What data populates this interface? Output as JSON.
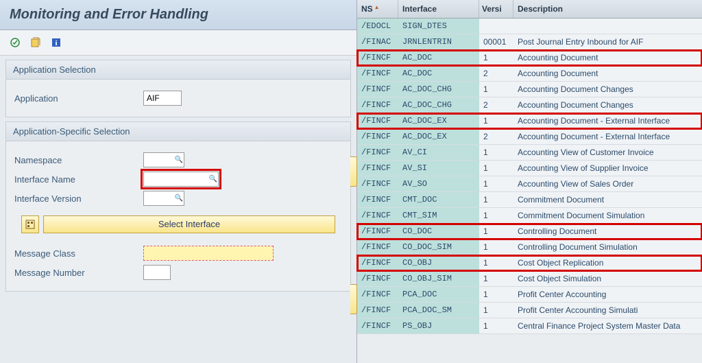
{
  "title": "Monitoring and Error Handling",
  "toolbar": {
    "execute_icon": "execute-icon",
    "variant_icon": "variant-icon",
    "info_icon": "info-icon"
  },
  "panels": {
    "appsel": {
      "title": "Application Selection",
      "app_label": "Application",
      "app_value": "AIF"
    },
    "specsel": {
      "title": "Application-Specific Selection",
      "ns_label": "Namespace",
      "ifname_label": "Interface Name",
      "ifver_label": "Interface Version",
      "select_btn": "Select Interface",
      "msgclass_label": "Message Class",
      "msgnum_label": "Message Number"
    }
  },
  "grid": {
    "headers": {
      "ns": "NS",
      "iface": "Interface",
      "version": "Versi",
      "desc": "Description"
    },
    "rows": [
      {
        "ns": "/EDOCL",
        "iface": "SIGN_DTES",
        "ver": "",
        "desc": "",
        "hl": false
      },
      {
        "ns": "/FINAC",
        "iface": "JRNLENTRIN",
        "ver": "00001",
        "desc": "Post Journal Entry Inbound for AIF",
        "hl": false
      },
      {
        "ns": "/FINCF",
        "iface": "AC_DOC",
        "ver": "1",
        "desc": "Accounting Document",
        "hl": true
      },
      {
        "ns": "/FINCF",
        "iface": "AC_DOC",
        "ver": "2",
        "desc": "Accounting Document",
        "hl": false
      },
      {
        "ns": "/FINCF",
        "iface": "AC_DOC_CHG",
        "ver": "1",
        "desc": "Accounting Document Changes",
        "hl": false
      },
      {
        "ns": "/FINCF",
        "iface": "AC_DOC_CHG",
        "ver": "2",
        "desc": "Accounting Document Changes",
        "hl": false
      },
      {
        "ns": "/FINCF",
        "iface": "AC_DOC_EX",
        "ver": "1",
        "desc": "Accounting Document - External Interface",
        "hl": true
      },
      {
        "ns": "/FINCF",
        "iface": "AC_DOC_EX",
        "ver": "2",
        "desc": "Accounting Document - External Interface",
        "hl": false
      },
      {
        "ns": "/FINCF",
        "iface": "AV_CI",
        "ver": "1",
        "desc": "Accounting View of Customer Invoice",
        "hl": false
      },
      {
        "ns": "/FINCF",
        "iface": "AV_SI",
        "ver": "1",
        "desc": "Accounting View of Supplier Invoice",
        "hl": false
      },
      {
        "ns": "/FINCF",
        "iface": "AV_SO",
        "ver": "1",
        "desc": "Accounting View of Sales Order",
        "hl": false
      },
      {
        "ns": "/FINCF",
        "iface": "CMT_DOC",
        "ver": "1",
        "desc": "Commitment Document",
        "hl": false
      },
      {
        "ns": "/FINCF",
        "iface": "CMT_SIM",
        "ver": "1",
        "desc": "Commitment Document Simulation",
        "hl": false
      },
      {
        "ns": "/FINCF",
        "iface": "CO_DOC",
        "ver": "1",
        "desc": "Controlling Document",
        "hl": true
      },
      {
        "ns": "/FINCF",
        "iface": "CO_DOC_SIM",
        "ver": "1",
        "desc": "Controlling Document Simulation",
        "hl": false
      },
      {
        "ns": "/FINCF",
        "iface": "CO_OBJ",
        "ver": "1",
        "desc": "Cost Object Replication",
        "hl": true
      },
      {
        "ns": "/FINCF",
        "iface": "CO_OBJ_SIM",
        "ver": "1",
        "desc": "Cost Object Simulation",
        "hl": false
      },
      {
        "ns": "/FINCF",
        "iface": "PCA_DOC",
        "ver": "1",
        "desc": "Profit Center Accounting",
        "hl": false
      },
      {
        "ns": "/FINCF",
        "iface": "PCA_DOC_SM",
        "ver": "1",
        "desc": "Profit Center Accounting Simulati",
        "hl": false
      },
      {
        "ns": "/FINCF",
        "iface": "PS_OBJ",
        "ver": "1",
        "desc": "Central Finance Project System Master Data",
        "hl": false
      }
    ]
  }
}
